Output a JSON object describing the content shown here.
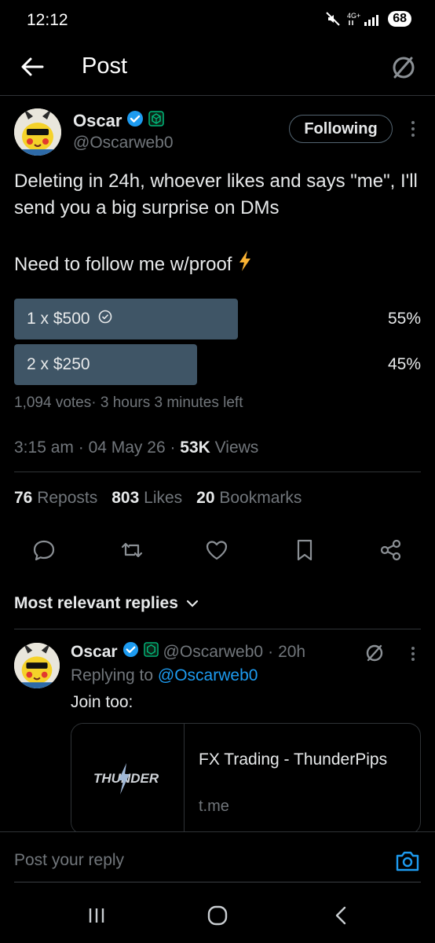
{
  "status_bar": {
    "time": "12:12",
    "network": "4G+",
    "battery": "68"
  },
  "header": {
    "title": "Post"
  },
  "post": {
    "author": {
      "name": "Oscar",
      "handle": "@Oscarweb0"
    },
    "follow_label": "Following",
    "text_line1": "Deleting in 24h, whoever likes and says \"me\", I'll send you a big surprise on DMs",
    "text_line2": "Need to follow me w/proof",
    "poll": {
      "options": [
        {
          "label": "1 x $500",
          "percent": "55%",
          "fraction": 0.55,
          "selected": true
        },
        {
          "label": "2 x $250",
          "percent": "45%",
          "fraction": 0.45,
          "selected": false
        }
      ],
      "meta": "1,094 votes· 3 hours 3 minutes left"
    },
    "time": "3:15 am",
    "date": "04 May 26",
    "views_count": "53K",
    "views_label": "Views",
    "stats": {
      "reposts_count": "76",
      "reposts_label": "Reposts",
      "likes_count": "803",
      "likes_label": "Likes",
      "bookmarks_count": "20",
      "bookmarks_label": "Bookmarks"
    }
  },
  "replies_header": "Most relevant replies",
  "reply": {
    "name": "Oscar",
    "handle": "@Oscarweb0",
    "age": "20h",
    "replying_prefix": "Replying to",
    "replying_to": "@Oscarweb0",
    "text": "Join too:",
    "card": {
      "logo_text": "THUNDER",
      "title": "FX Trading - ThunderPips",
      "domain": "t.me"
    }
  },
  "composer": {
    "placeholder": "Post your reply"
  },
  "colors": {
    "background": "#000000",
    "accent": "#1d9bf0",
    "poll_bar": "#3f5566",
    "verified": "#1d9bf0",
    "affiliate": "#00ba7c",
    "secondary_text": "#71767b"
  }
}
